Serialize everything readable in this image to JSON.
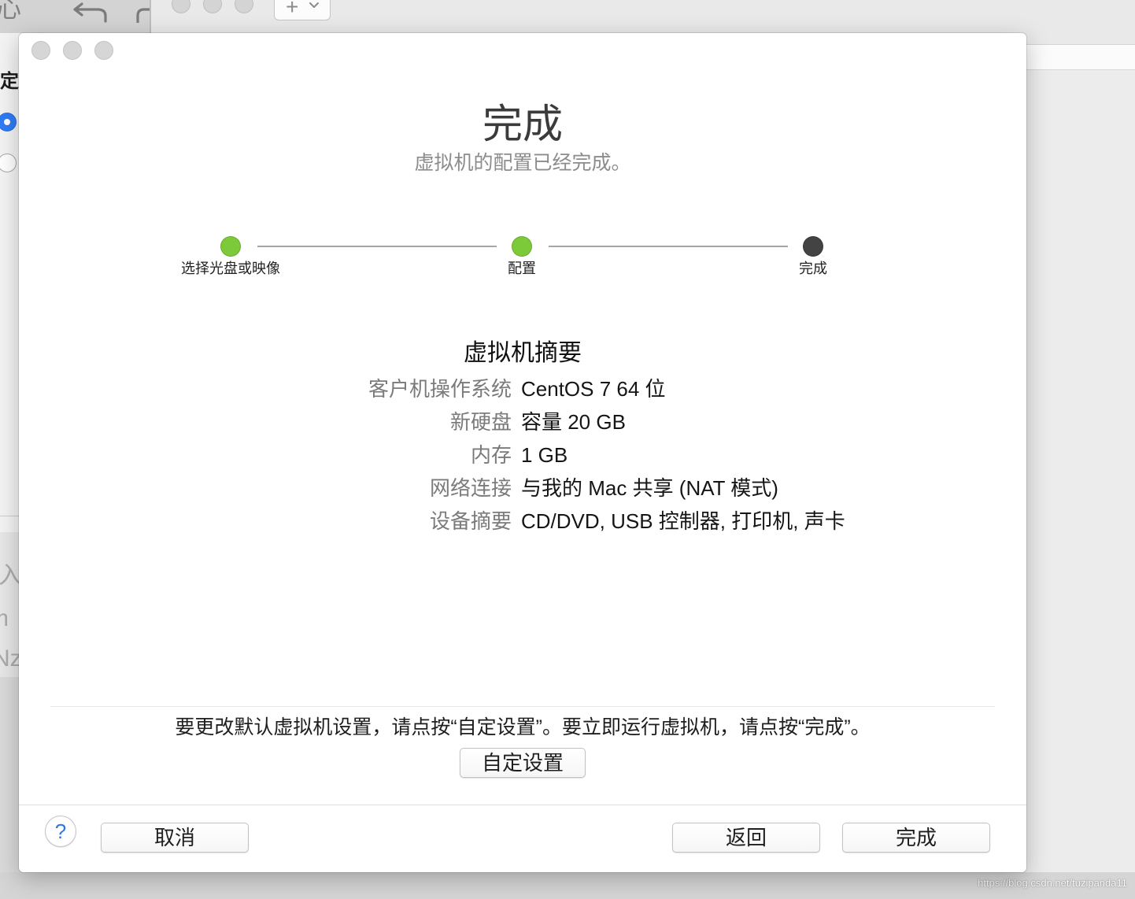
{
  "background": {
    "toolbar": {
      "left_glyph": "心",
      "add_label": "+"
    },
    "sidebar": {
      "heading": "定",
      "radios": [
        {
          "checked": true
        },
        {
          "checked": false
        }
      ],
      "fragments": [
        "入",
        "m",
        "Nz"
      ]
    },
    "watermark": "https://blog.csdn.net/tuzipanda11"
  },
  "dialog": {
    "title": "完成",
    "subtitle": "虚拟机的配置已经完成。",
    "steps": [
      {
        "label": "选择光盘或映像",
        "color": "#7cc93a"
      },
      {
        "label": "配置",
        "color": "#7cc93a"
      },
      {
        "label": "完成",
        "color": "#434343"
      }
    ],
    "summary": {
      "heading": "虚拟机摘要",
      "rows": [
        {
          "label": "客户机操作系统",
          "value": "CentOS 7 64 位"
        },
        {
          "label": "新硬盘",
          "value": "容量 20 GB"
        },
        {
          "label": "内存",
          "value": "1 GB"
        },
        {
          "label": "网络连接",
          "value": "与我的 Mac 共享 (NAT 模式)"
        },
        {
          "label": "设备摘要",
          "value": "CD/DVD, USB 控制器, 打印机, 声卡"
        }
      ]
    },
    "hint": "要更改默认虚拟机设置，请点按“自定设置”。要立即运行虚拟机，请点按“完成”。",
    "customize_label": "自定设置",
    "footer": {
      "help_label": "?",
      "cancel_label": "取消",
      "back_label": "返回",
      "finish_label": "完成"
    }
  },
  "colors": {
    "accent": "#2f7cf6",
    "help_glyph": "#2a7ae2"
  },
  "icons": {
    "toolbar_back": "back-arrow-icon",
    "toolbar_forward": "forward-arrow-icon",
    "add_menu": "chevron-down-icon",
    "help": "question-mark-icon"
  }
}
